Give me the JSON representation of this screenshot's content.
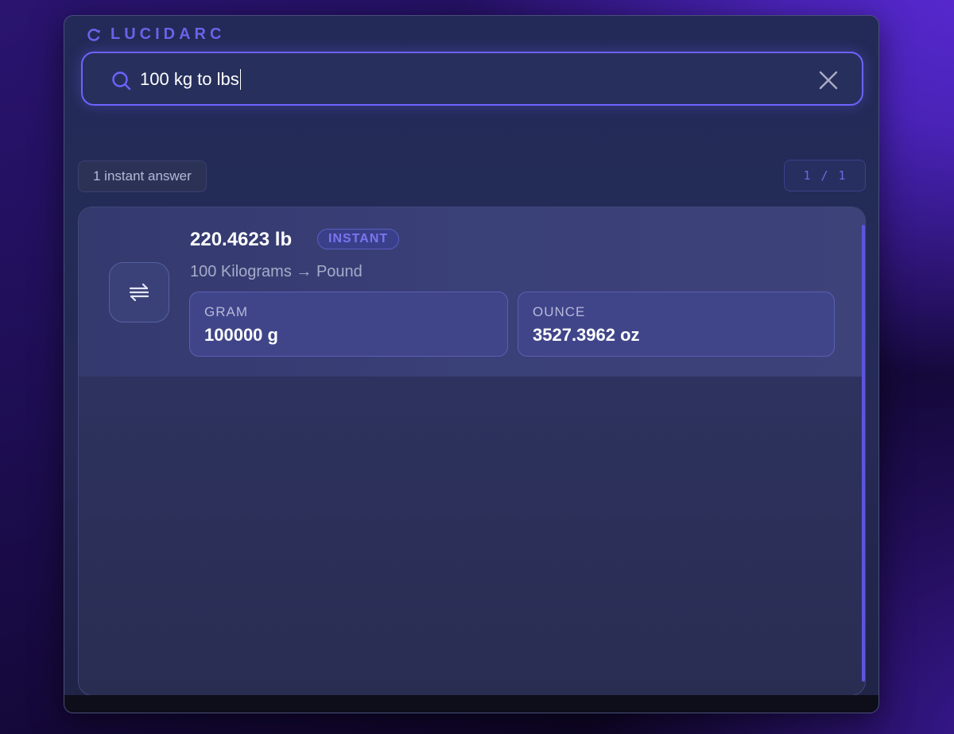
{
  "brand": {
    "name": "LUCIDARC"
  },
  "search": {
    "query": "100 kg to lbs"
  },
  "results_meta": {
    "count_label": "1 instant answer",
    "page_current": "1",
    "page_sep": "/",
    "page_total": "1"
  },
  "result": {
    "title": "220.4623 lb",
    "badge": "INSTANT",
    "subtitle": "100 Kilograms → Pound",
    "icon": "swap-arrows-icon",
    "conversions": [
      {
        "label": "GRAM",
        "value": "100000 g"
      },
      {
        "label": "OUNCE",
        "value": "3527.3962 oz"
      }
    ]
  },
  "colors": {
    "accent": "#6c63ff",
    "badge_text": "#7b75f0",
    "brand": "#6a63e8"
  }
}
